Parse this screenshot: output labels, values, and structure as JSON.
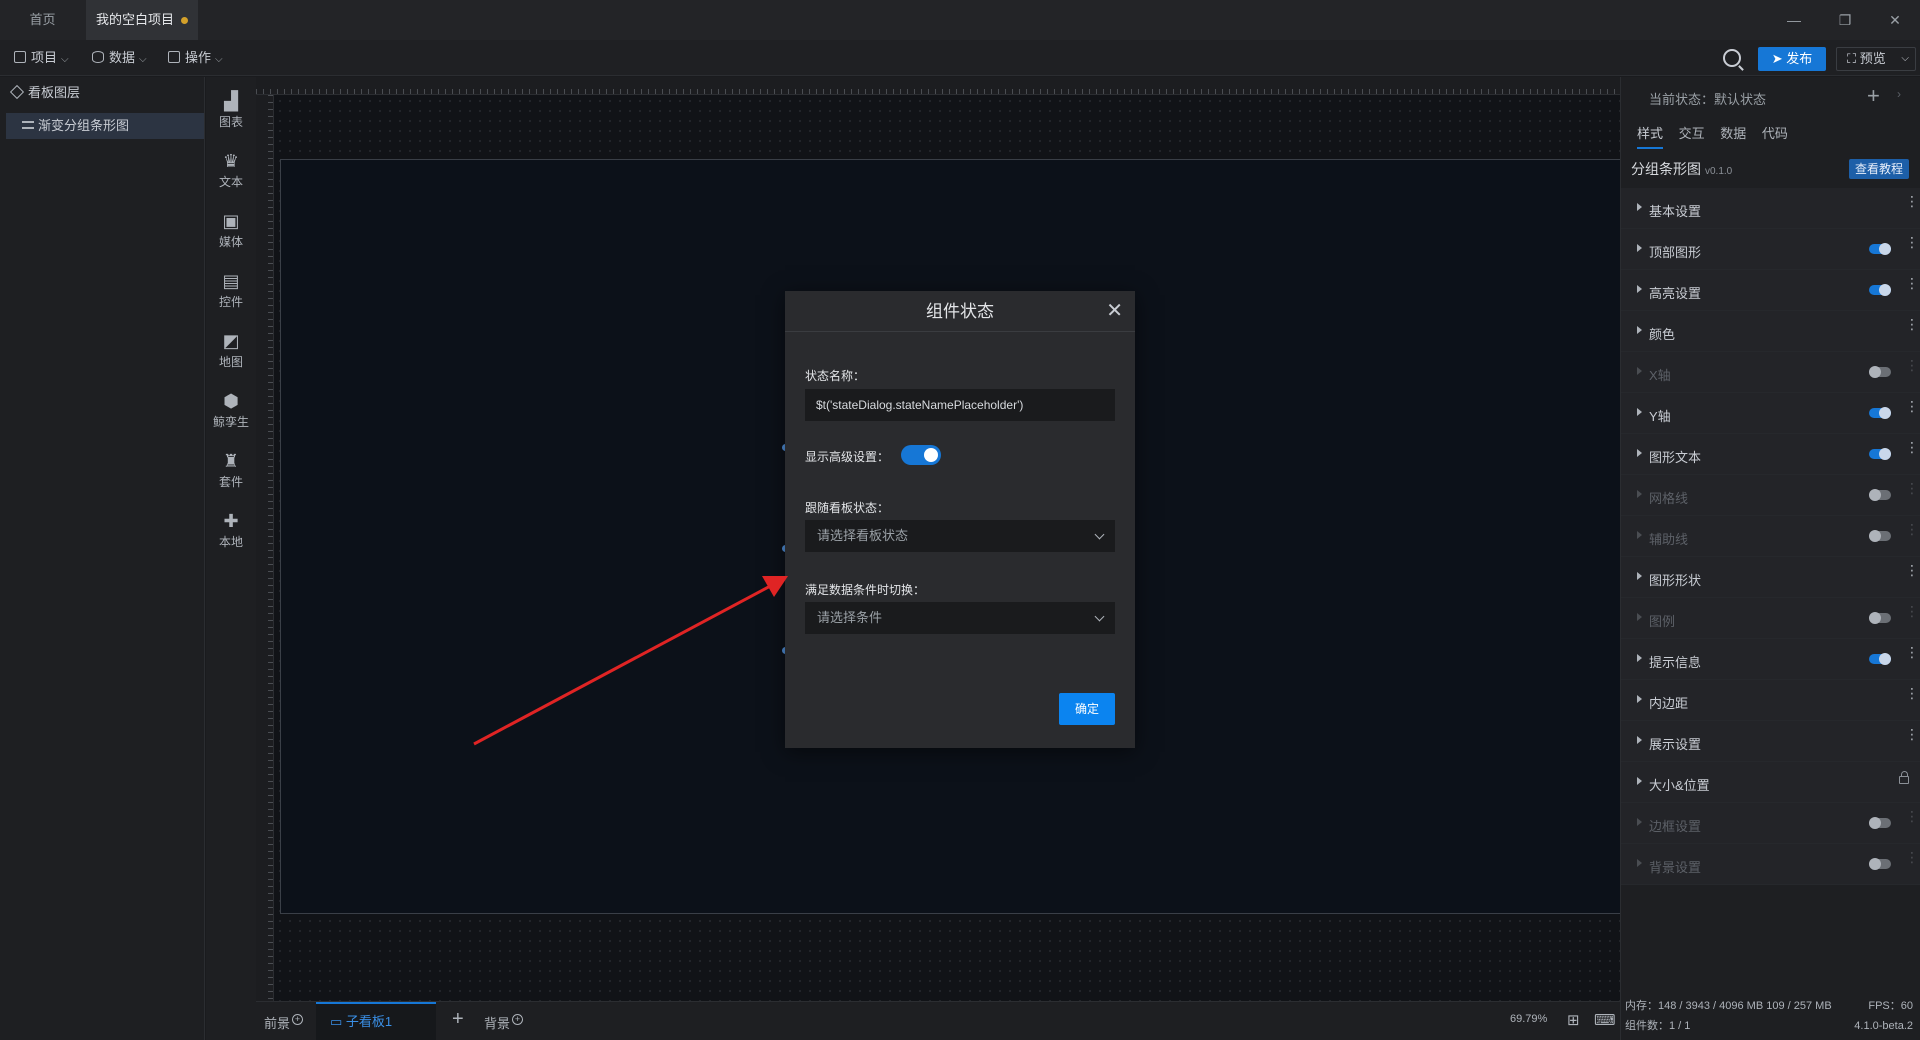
{
  "tabs": {
    "home": "首页",
    "project": "我的空白项目"
  },
  "menu": {
    "project": "项目",
    "data": "数据",
    "operate": "操作",
    "publish": "发布",
    "preview": "预览"
  },
  "layers": {
    "title": "看板图层",
    "items": [
      "渐变分组条形图"
    ]
  },
  "components": [
    "图表",
    "文本",
    "媒体",
    "控件",
    "地图",
    "鲸孪生",
    "套件",
    "本地"
  ],
  "bottom": {
    "foreground": "前景",
    "subboard": "子看板1",
    "background": "背景",
    "zoom": "69.79%"
  },
  "right_panel": {
    "state_label": "当前状态：默认状态",
    "tabs": [
      "样式",
      "交互",
      "数据",
      "代码"
    ],
    "component_name": "分组条形图",
    "version": "v0.1.0",
    "tutorial": "查看教程",
    "sections": [
      {
        "label": "基本设置",
        "toggle": "none",
        "disabled": false
      },
      {
        "label": "顶部图形",
        "toggle": "on",
        "disabled": false
      },
      {
        "label": "高亮设置",
        "toggle": "on",
        "disabled": false
      },
      {
        "label": "颜色",
        "toggle": "none",
        "disabled": false
      },
      {
        "label": "X轴",
        "toggle": "off",
        "disabled": true
      },
      {
        "label": "Y轴",
        "toggle": "on",
        "disabled": false
      },
      {
        "label": "图形文本",
        "toggle": "on",
        "disabled": false
      },
      {
        "label": "网格线",
        "toggle": "off",
        "disabled": true
      },
      {
        "label": "辅助线",
        "toggle": "off",
        "disabled": true
      },
      {
        "label": "图形形状",
        "toggle": "none",
        "disabled": false
      },
      {
        "label": "图例",
        "toggle": "off",
        "disabled": true
      },
      {
        "label": "提示信息",
        "toggle": "on",
        "disabled": false
      },
      {
        "label": "内边距",
        "toggle": "none",
        "disabled": false
      },
      {
        "label": "展示设置",
        "toggle": "none",
        "disabled": false
      },
      {
        "label": "大小&位置",
        "toggle": "lock",
        "disabled": false
      },
      {
        "label": "边框设置",
        "toggle": "off",
        "disabled": true
      },
      {
        "label": "背景设置",
        "toggle": "off",
        "disabled": true
      }
    ],
    "footer": {
      "memory": "内存：148 / 3943 / 4096 MB  109 / 257 MB",
      "fps": "FPS：60",
      "count": "组件数：1 / 1",
      "version": "4.1.0-beta.2"
    }
  },
  "modal": {
    "title": "组件状态",
    "state_name_label": "状态名称：",
    "state_name_value": "$t('stateDialog.stateNamePlaceholder')",
    "advanced_label": "显示高级设置：",
    "follow_label": "跟随看板状态：",
    "follow_placeholder": "请选择看板状态",
    "condition_label": "满足数据条件时切换：",
    "condition_placeholder": "请选择条件",
    "confirm": "确定"
  },
  "colors": {
    "accent": "#1677d6",
    "annotation_arrow": "#e02424"
  }
}
